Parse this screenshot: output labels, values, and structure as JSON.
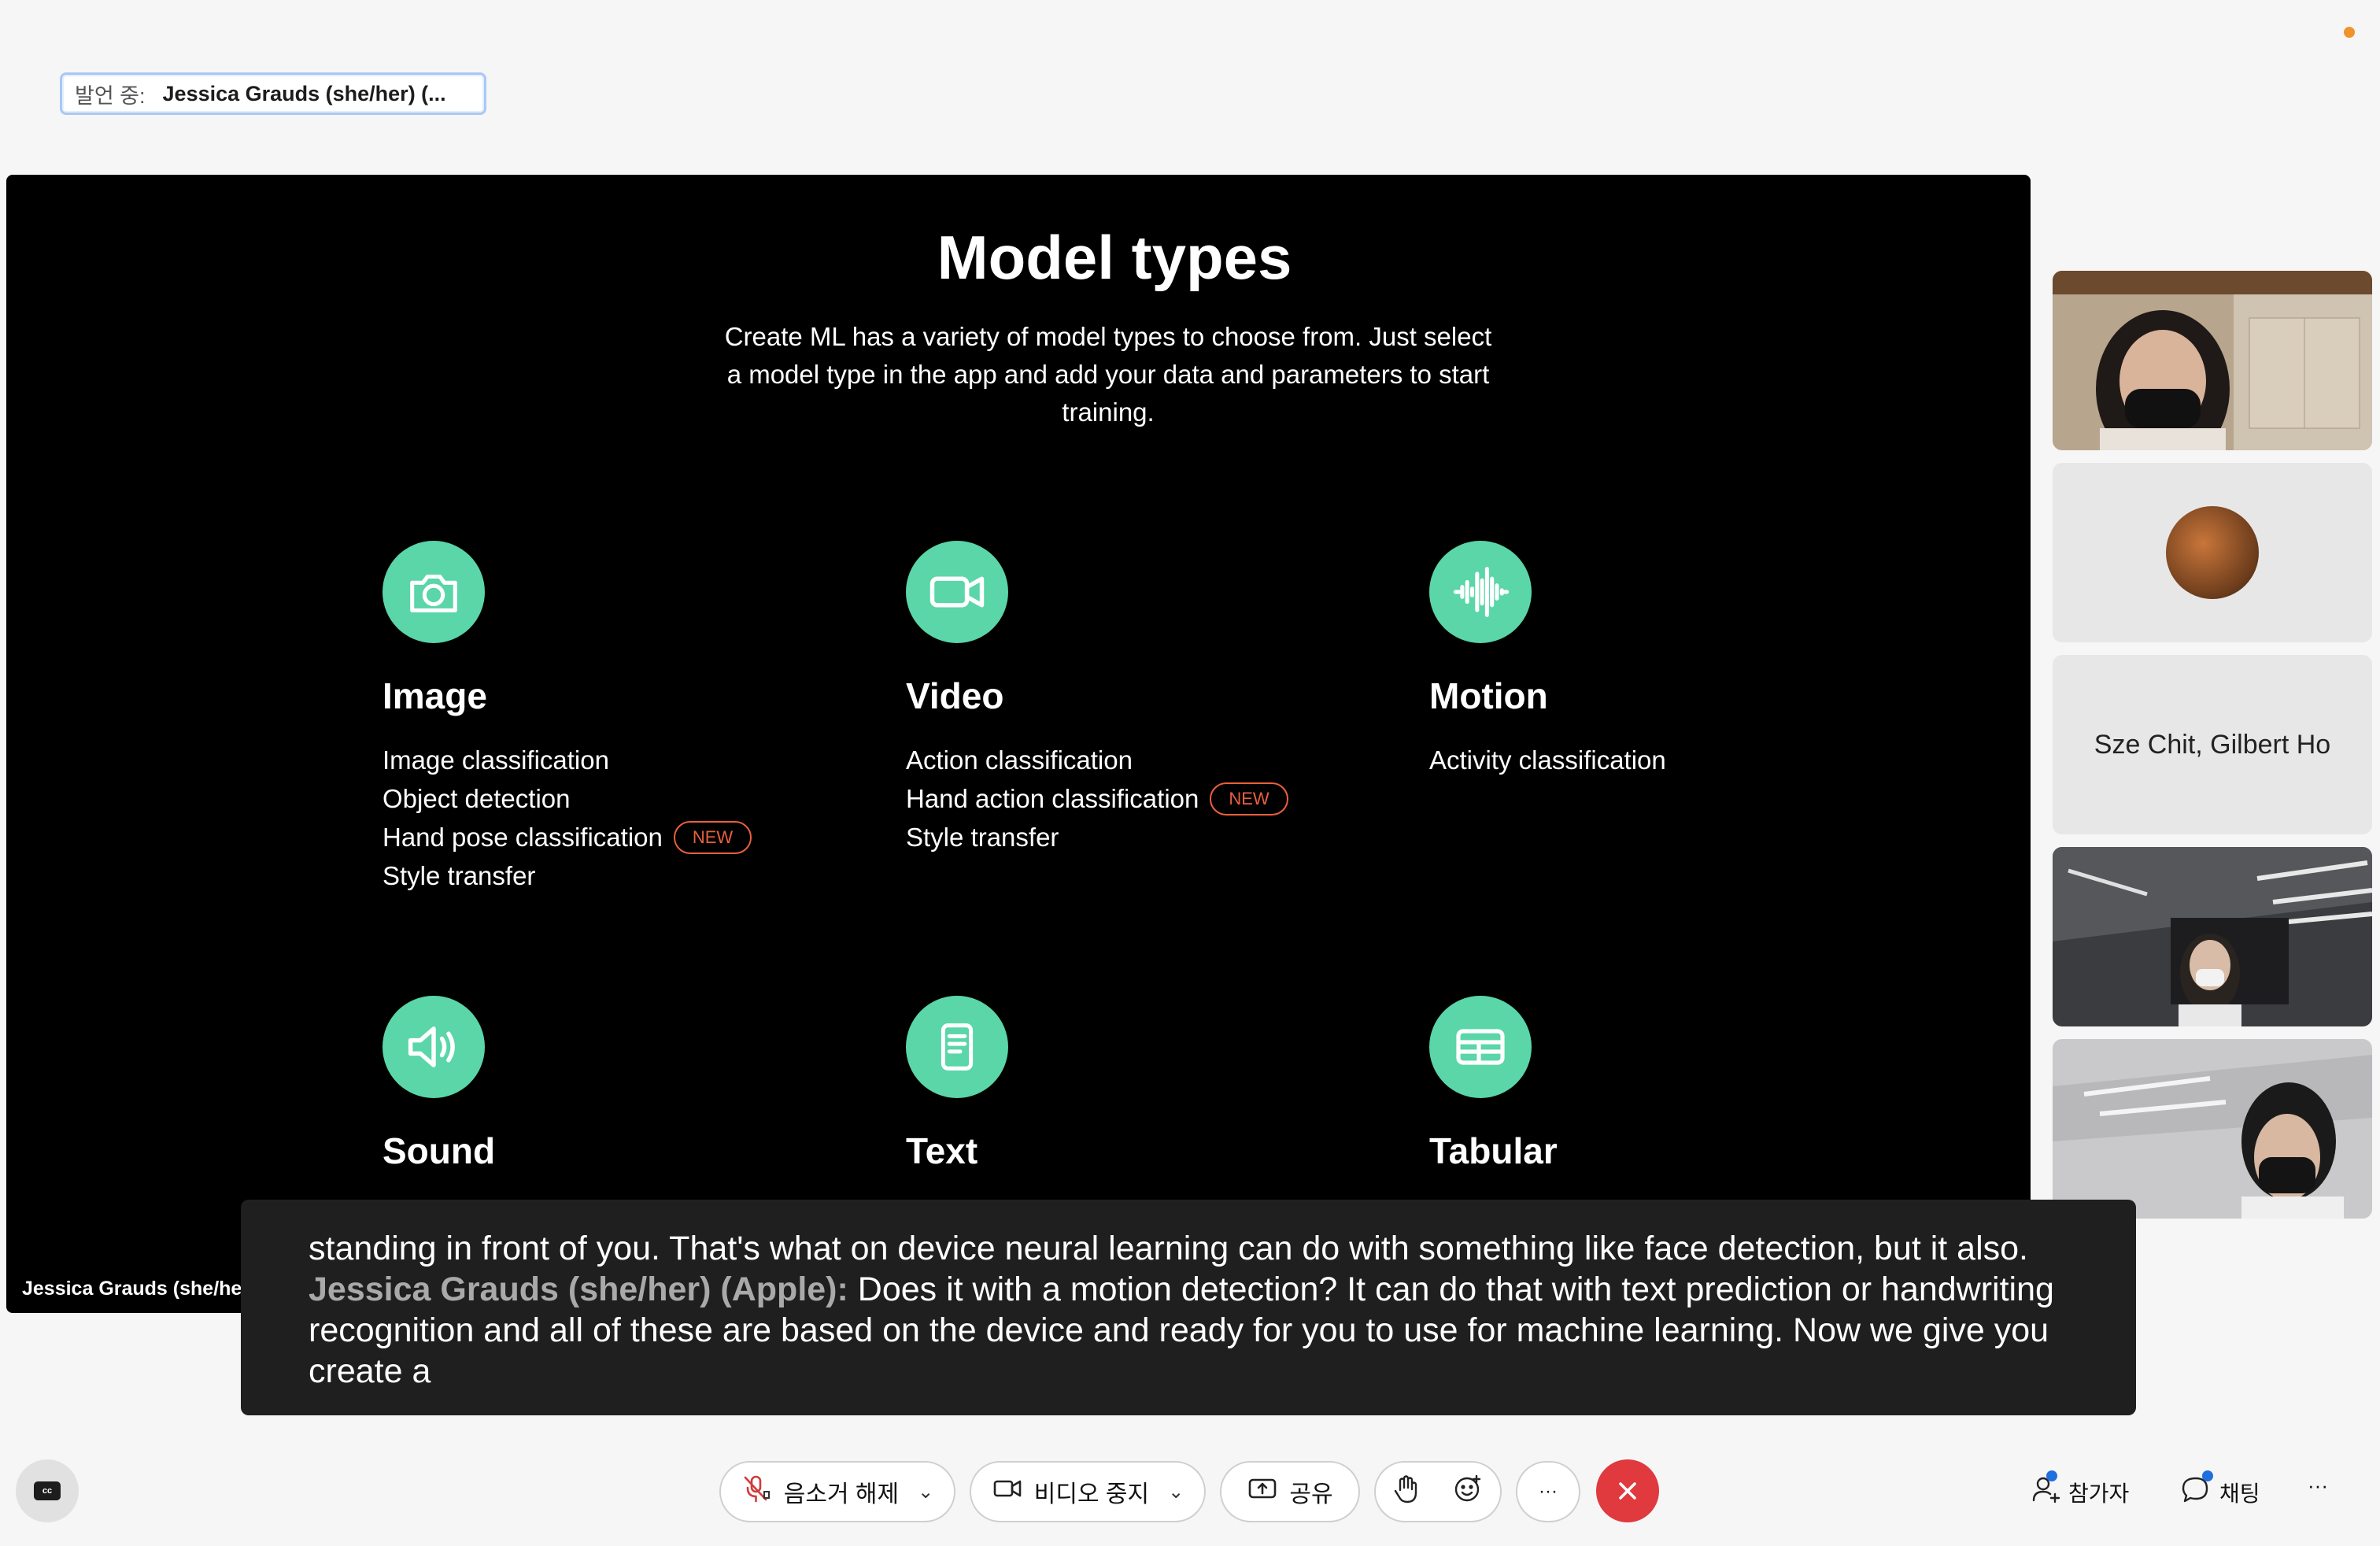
{
  "speaking": {
    "label": "발언 중:",
    "name": "Jessica Grauds (she/her) (..."
  },
  "slide": {
    "title": "Model types",
    "subtitle": "Create ML has a variety of model types to choose from. Just select a model type in the app and add your data and parameters to start training.",
    "categories": [
      {
        "icon": "camera-icon",
        "name": "Image",
        "items": [
          "Image classification",
          "Object detection",
          "Hand pose classification",
          "Style transfer"
        ],
        "new_on": "Hand pose classification"
      },
      {
        "icon": "video-icon",
        "name": "Video",
        "items": [
          "Action classification",
          "Hand action classification",
          "Style transfer"
        ],
        "new_on": "Hand action classification"
      },
      {
        "icon": "waveform-icon",
        "name": "Motion",
        "items": [
          "Activity classification"
        ]
      },
      {
        "icon": "speaker-icon",
        "name": "Sound",
        "items": []
      },
      {
        "icon": "document-icon",
        "name": "Text",
        "items": []
      },
      {
        "icon": "table-icon",
        "name": "Tabular",
        "items": []
      }
    ],
    "badge_label": "NEW",
    "accent_color": "#5ad6a9",
    "badge_color": "#e9603c"
  },
  "stage_name": "Jessica Grauds (she/her",
  "caption": {
    "line1": "standing in front of you. That's what on device neural learning can do with something like face detection, but it also.",
    "speaker": "Jessica Grauds (she/her) (Apple):",
    "rest": "Does it with a motion detection? It can do that with text prediction or handwriting recognition and all of these are based on the device and ready for you to use for machine learning. Now we give you create a"
  },
  "participants": {
    "named_tile": "Sze Chit, Gilbert Ho"
  },
  "controls": {
    "unmute": "음소거 해제",
    "stop_video": "비디오 중지",
    "share": "공유",
    "more": "···",
    "participants": "참가자",
    "chat": "채팅",
    "overflow": "···"
  },
  "colors": {
    "end_call": "#e0393e",
    "notify_dot": "#1f6fde",
    "status_dot": "#f0932b"
  }
}
